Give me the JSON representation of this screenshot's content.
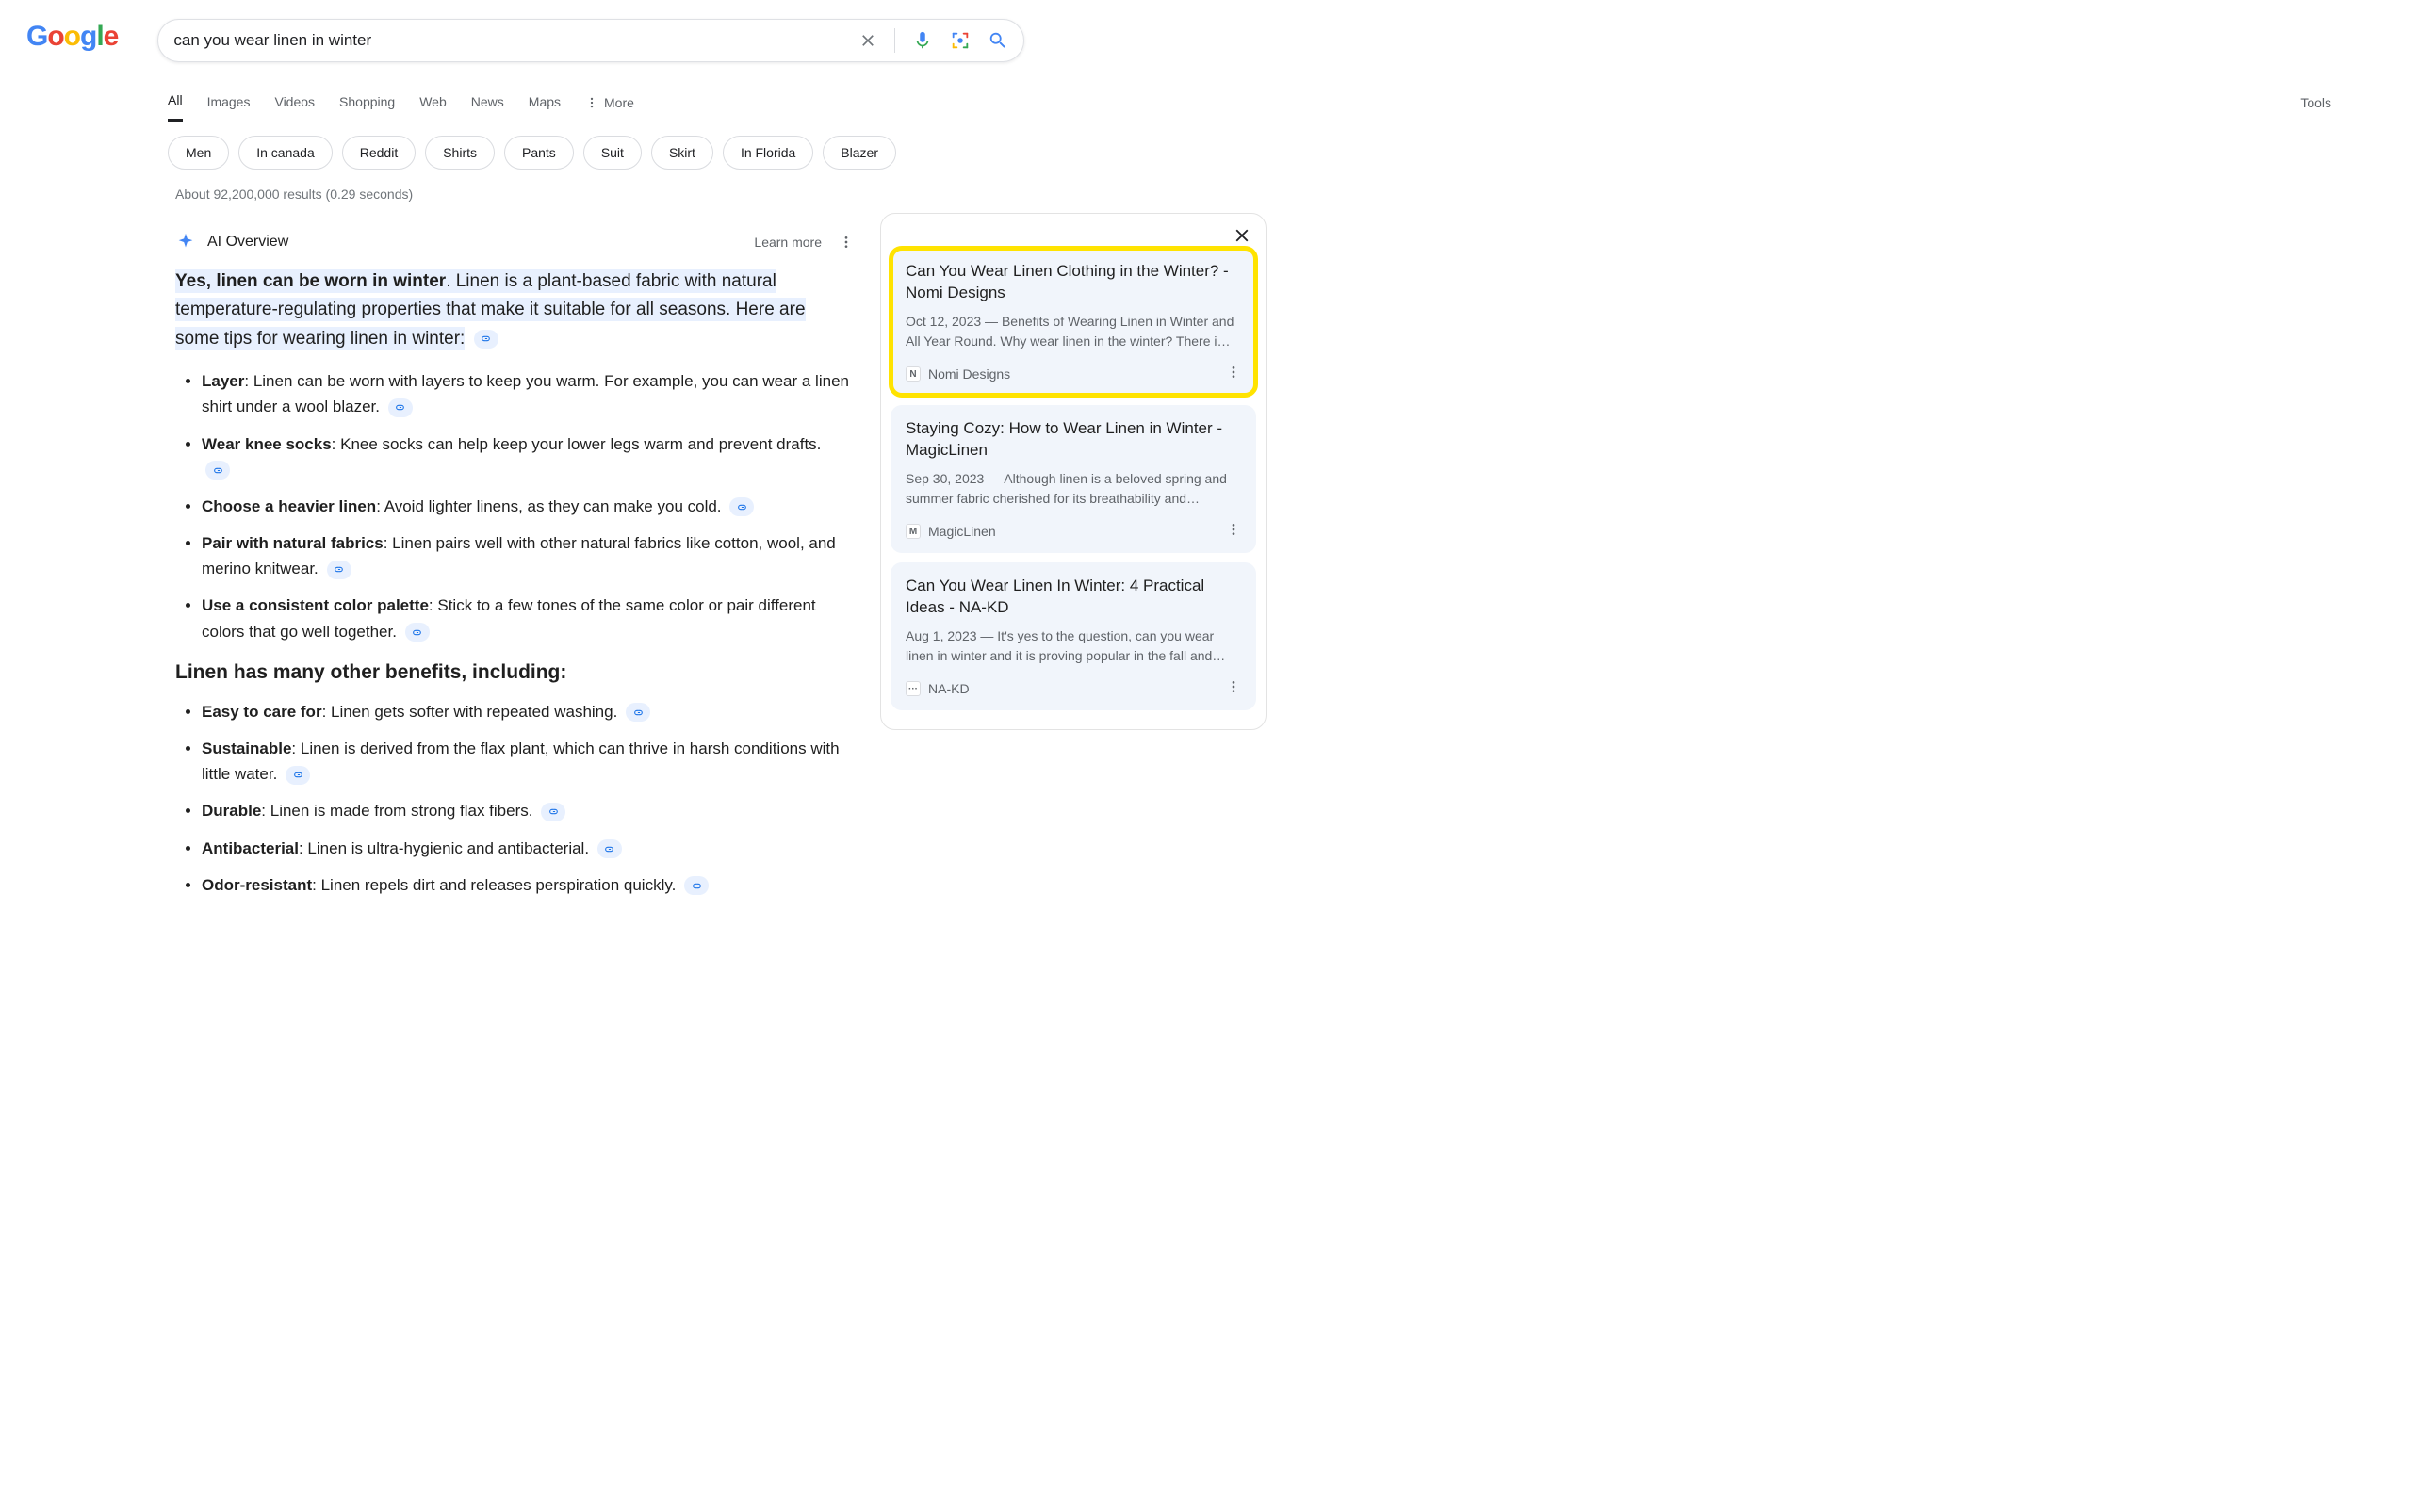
{
  "search": {
    "query": "can you wear linen in winter"
  },
  "tabs": [
    "All",
    "Images",
    "Videos",
    "Shopping",
    "Web",
    "News",
    "Maps"
  ],
  "more_label": "More",
  "tools_label": "Tools",
  "chips": [
    "Men",
    "In canada",
    "Reddit",
    "Shirts",
    "Pants",
    "Suit",
    "Skirt",
    "In Florida",
    "Blazer"
  ],
  "result_stats": "About 92,200,000 results (0.29 seconds)",
  "ai": {
    "label": "AI Overview",
    "learn_more": "Learn more",
    "lead_bold": "Yes, linen can be worn in winter",
    "lead_rest": ". Linen is a plant-based fabric with natural temperature-regulating properties that make it suitable for all seasons. Here are some tips for wearing linen in winter:",
    "tips": [
      {
        "b": "Layer",
        "t": ": Linen can be worn with layers to keep you warm. For example, you can wear a linen shirt under a wool blazer."
      },
      {
        "b": "Wear knee socks",
        "t": ": Knee socks can help keep your lower legs warm and prevent drafts."
      },
      {
        "b": "Choose a heavier linen",
        "t": ": Avoid lighter linens, as they can make you cold."
      },
      {
        "b": "Pair with natural fabrics",
        "t": ": Linen pairs well with other natural fabrics like cotton, wool, and merino knitwear."
      },
      {
        "b": "Use a consistent color palette",
        "t": ": Stick to a few tones of the same color or pair different colors that go well together."
      }
    ],
    "benefits_head": "Linen has many other benefits, including:",
    "benefits": [
      {
        "b": "Easy to care for",
        "t": ": Linen gets softer with repeated washing."
      },
      {
        "b": "Sustainable",
        "t": ": Linen is derived from the flax plant, which can thrive in harsh conditions with little water."
      },
      {
        "b": "Durable",
        "t": ": Linen is made from strong flax fibers."
      },
      {
        "b": "Antibacterial",
        "t": ": Linen is ultra-hygienic and antibacterial."
      },
      {
        "b": "Odor-resistant",
        "t": ": Linen repels dirt and releases perspiration quickly."
      }
    ]
  },
  "sources": [
    {
      "title": "Can You Wear Linen Clothing in the Winter? - Nomi Designs",
      "snippet": "Oct 12, 2023 — Benefits of Wearing Linen in Winter and All Year Round. Why wear linen in the winter? There i…",
      "site": "Nomi Designs",
      "fav": "N",
      "highlight": true
    },
    {
      "title": "Staying Cozy: How to Wear Linen in Winter - MagicLinen",
      "snippet": "Sep 30, 2023 — Although linen is a beloved spring and summer fabric cherished for its breathability and…",
      "site": "MagicLinen",
      "fav": "M",
      "highlight": false
    },
    {
      "title": "Can You Wear Linen In Winter: 4 Practical Ideas - NA-KD",
      "snippet": "Aug 1, 2023 — It's yes to the question, can you wear linen in winter and it is proving popular in the fall and…",
      "site": "NA-KD",
      "fav": "···",
      "highlight": false
    }
  ]
}
